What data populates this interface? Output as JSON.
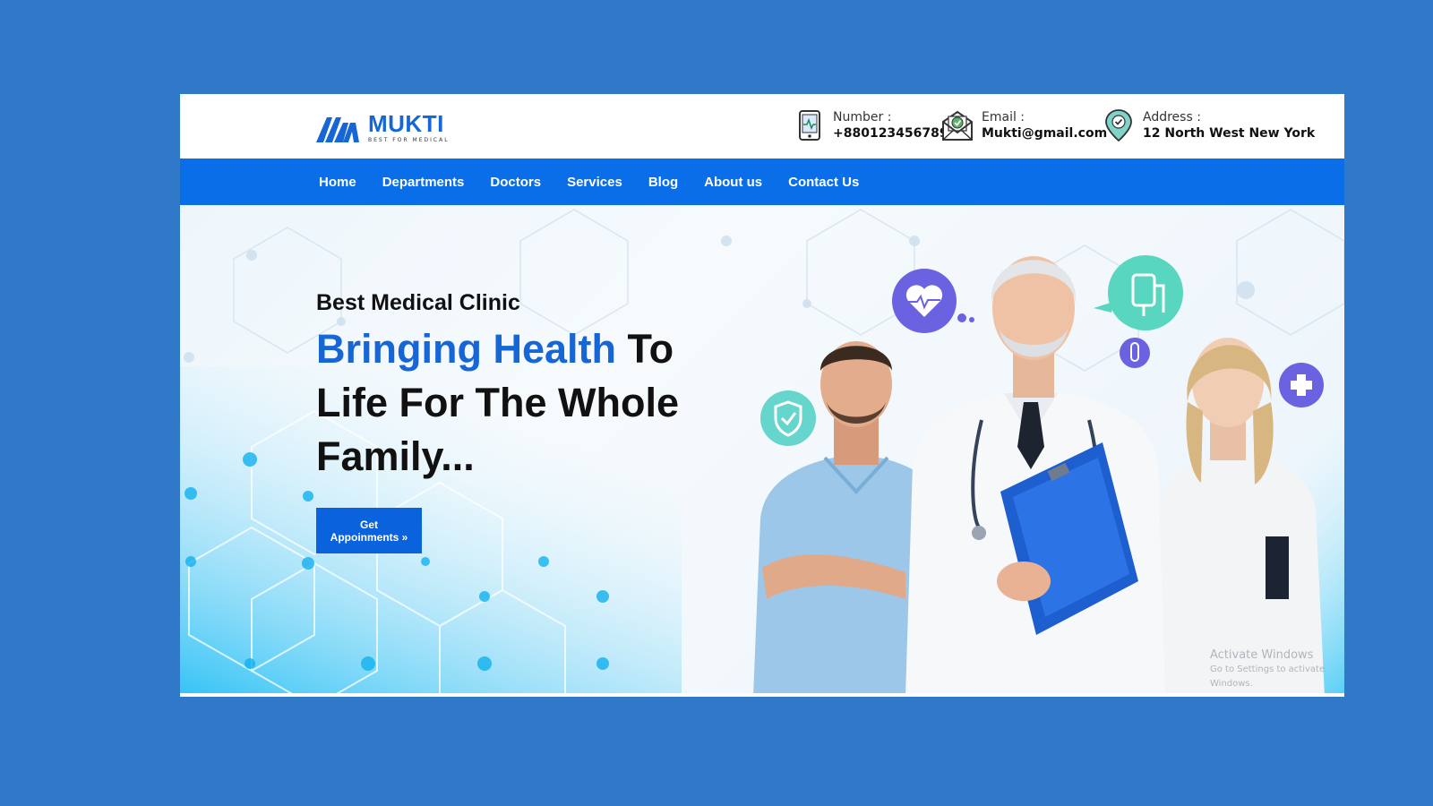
{
  "brand": {
    "name": "MUKTI",
    "tagline": "BEST FOR MEDICAL",
    "color": "#1666d6"
  },
  "contacts": {
    "number": {
      "label": "Number :",
      "value": "+880123456789",
      "icon": "phone-device-icon"
    },
    "email": {
      "label": "Email :",
      "value": "Mukti@gmail.com",
      "icon": "envelope-icon"
    },
    "address": {
      "label": "Address :",
      "value": "12 North West New York",
      "icon": "location-pin-icon"
    }
  },
  "nav": {
    "items": [
      "Home",
      "Departments",
      "Doctors",
      "Services",
      "Blog",
      "About us",
      "Contact Us"
    ],
    "background": "#0a6ee8"
  },
  "hero": {
    "eyebrow": "Best Medical Clinic",
    "headline_accent": "Bringing Health",
    "headline_rest": " To Life For The Whole Family...",
    "cta_line1": "Get",
    "cta_line2": "Appoinments »",
    "floating_icons": [
      "heart-pulse-icon",
      "iv-bag-icon",
      "shield-check-icon",
      "plus-icon",
      "test-tube-icon"
    ]
  },
  "watermark": {
    "line1": "Activate Windows",
    "line2": "Go to Settings to activate Windows."
  },
  "colors": {
    "page_background": "#3079c8",
    "accent": "#0a63dd"
  }
}
